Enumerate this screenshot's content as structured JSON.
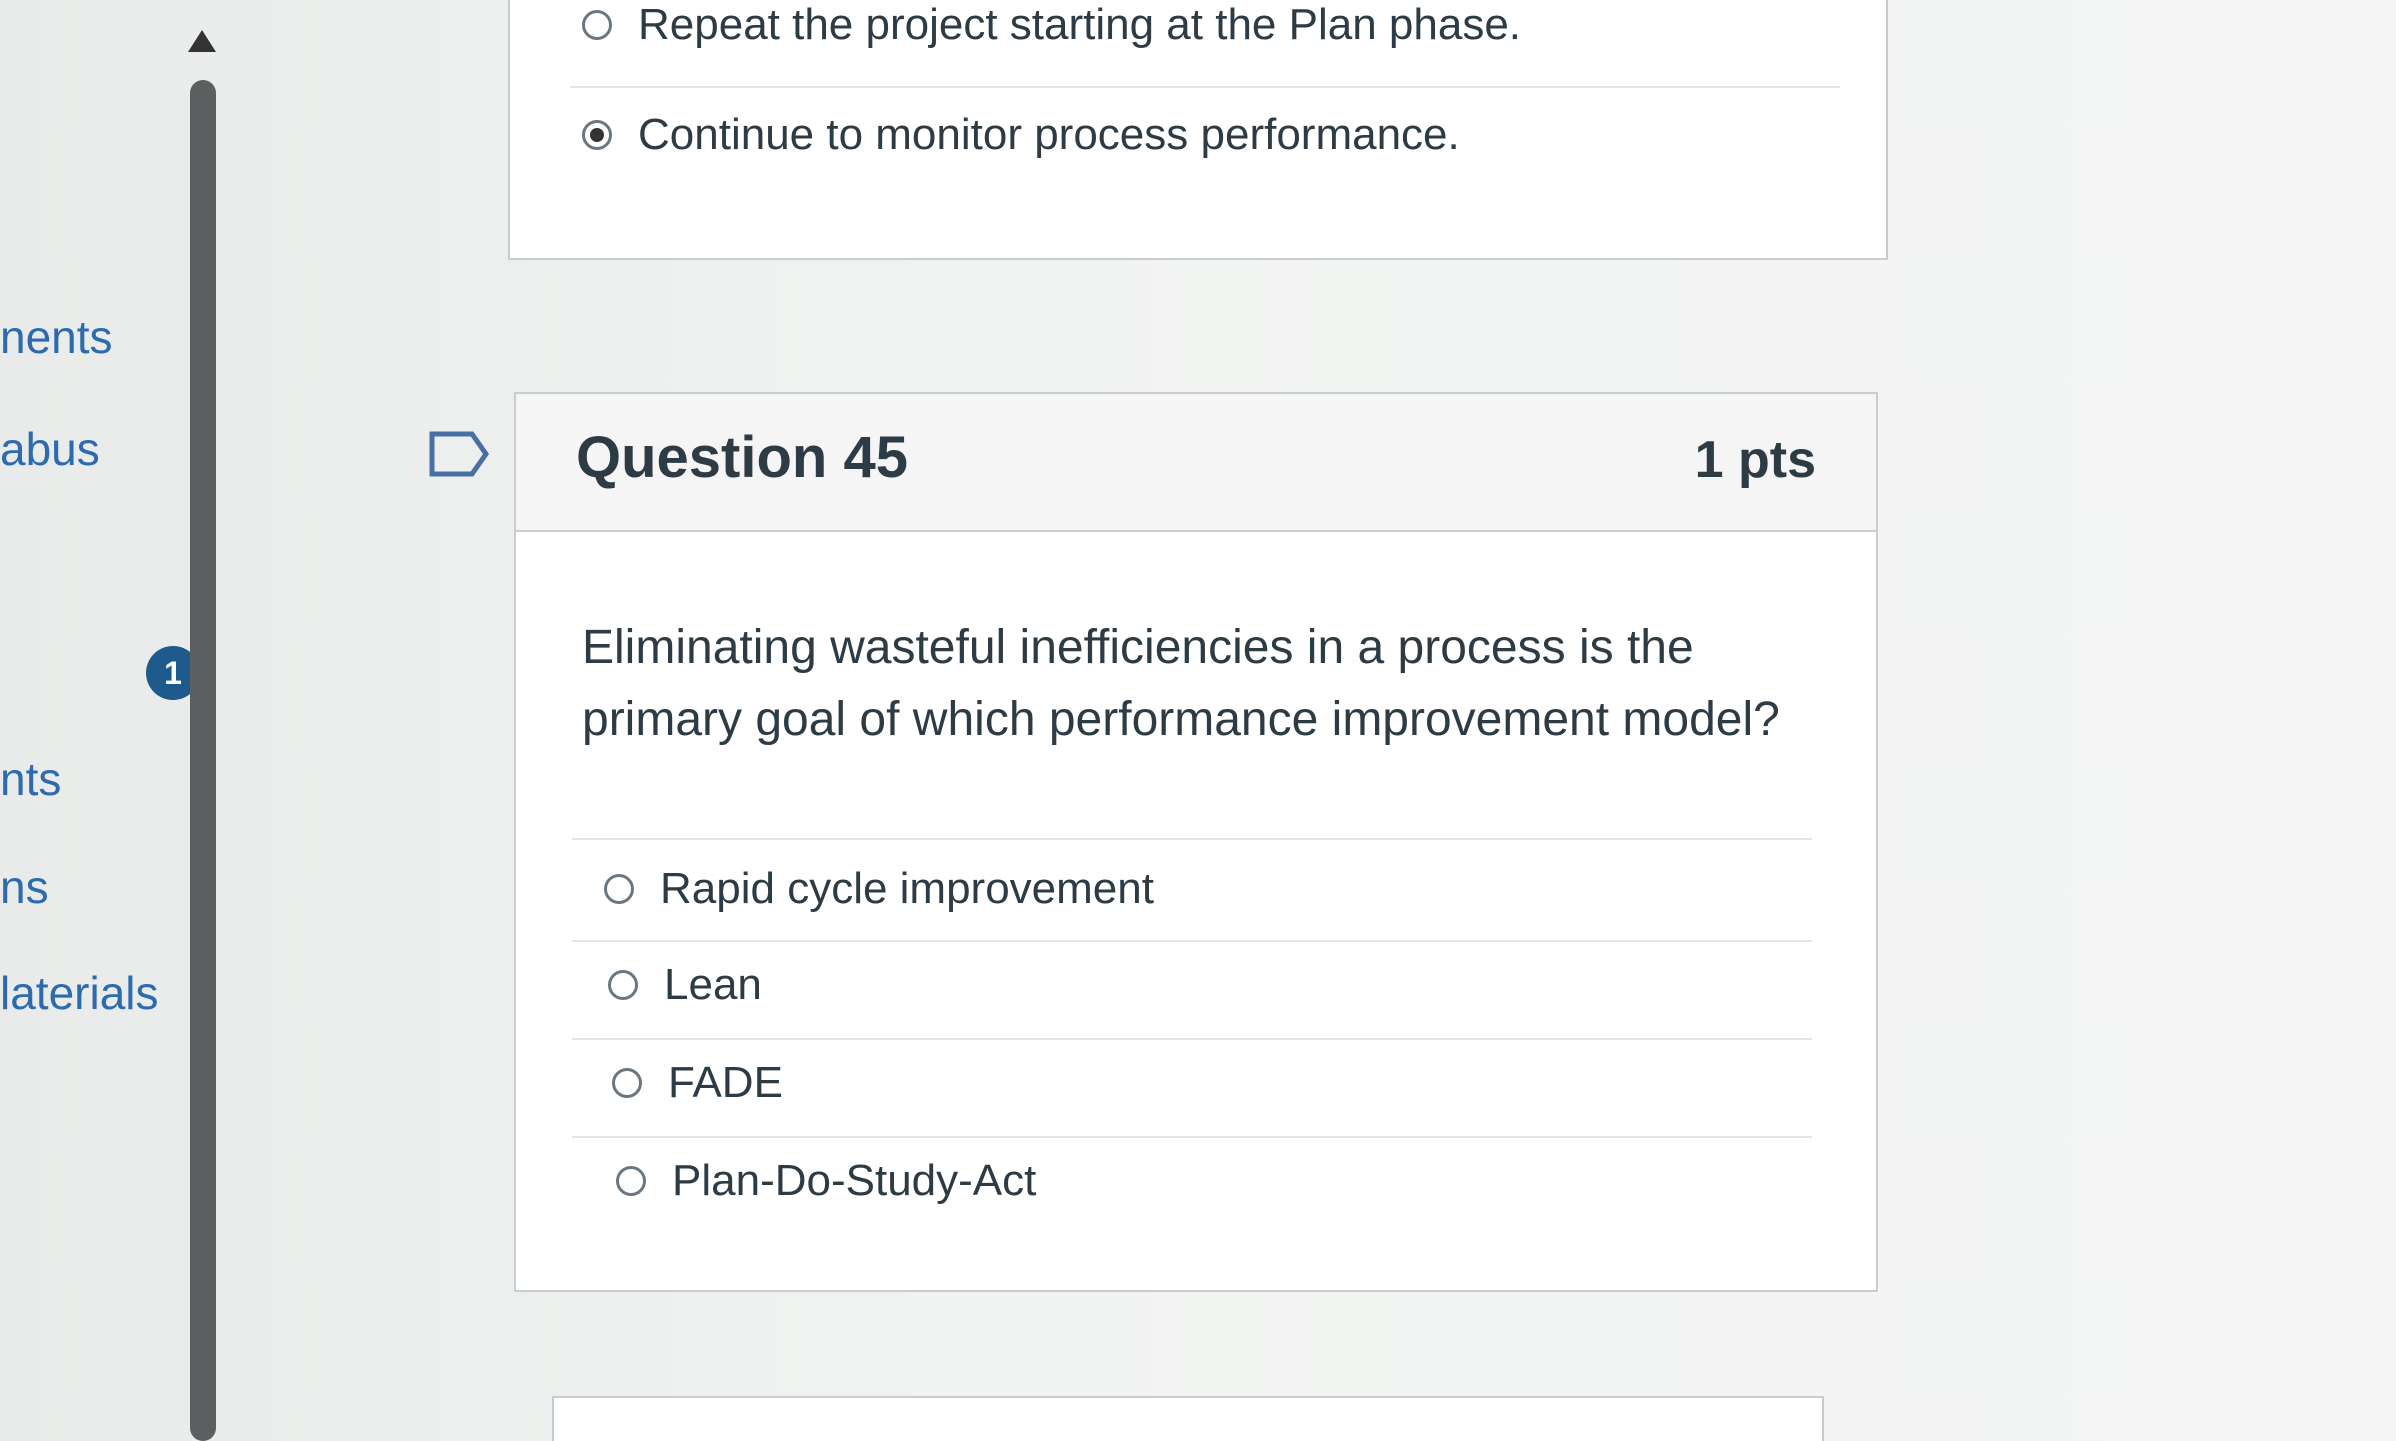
{
  "nav": {
    "items": [
      {
        "label": "nents"
      },
      {
        "label": "abus"
      },
      {
        "label": "nts"
      },
      {
        "label": "ns"
      },
      {
        "label": "laterials"
      }
    ],
    "badge": "1"
  },
  "previous_question": {
    "answers": [
      {
        "label": "Repeat the project starting at the Plan phase.",
        "selected": false
      },
      {
        "label": "Continue to monitor process performance.",
        "selected": true
      }
    ]
  },
  "question": {
    "title": "Question 45",
    "points": "1 pts",
    "text": "Eliminating wasteful inefficiencies in a process is the primary goal of which performance improvement model?",
    "answers": [
      {
        "label": "Rapid cycle improvement",
        "selected": false
      },
      {
        "label": "Lean",
        "selected": false
      },
      {
        "label": "FADE",
        "selected": false
      },
      {
        "label": "Plan-Do-Study-Act",
        "selected": false
      }
    ]
  },
  "icons": {
    "flag": "flag-question-icon",
    "scroll_up": "scroll-up-arrow-icon"
  },
  "colors": {
    "link": "#2d6ab0",
    "badge": "#1f5a8c",
    "text": "#2d3b45",
    "border": "#c7cdd1"
  }
}
